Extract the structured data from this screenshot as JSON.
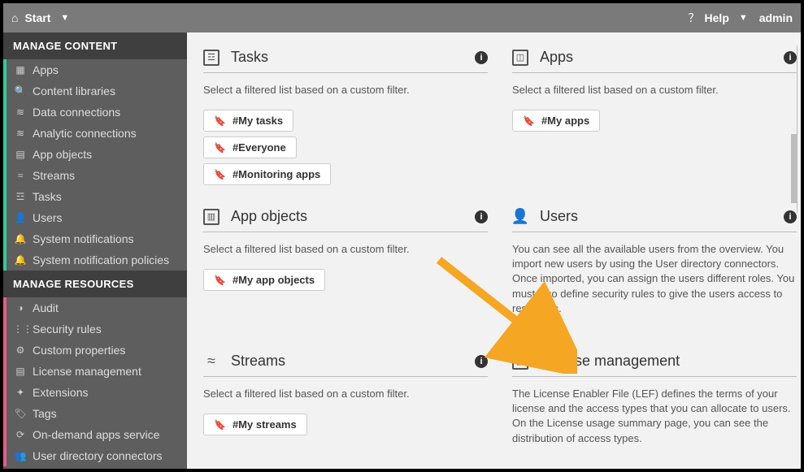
{
  "topbar": {
    "title": "Start",
    "help": "Help",
    "user": "admin"
  },
  "sidebar": {
    "head1": "MANAGE CONTENT",
    "head2": "MANAGE RESOURCES",
    "content": [
      {
        "label": "Apps",
        "icon": "▦"
      },
      {
        "label": "Content libraries",
        "icon": "🔍"
      },
      {
        "label": "Data connections",
        "icon": "≋"
      },
      {
        "label": "Analytic connections",
        "icon": "≋"
      },
      {
        "label": "App objects",
        "icon": "▤"
      },
      {
        "label": "Streams",
        "icon": "≈"
      },
      {
        "label": "Tasks",
        "icon": "☲"
      },
      {
        "label": "Users",
        "icon": "👤"
      },
      {
        "label": "System notifications",
        "icon": "🔔"
      },
      {
        "label": "System notification policies",
        "icon": "🔔"
      }
    ],
    "resources": [
      {
        "label": "Audit",
        "icon": "◑"
      },
      {
        "label": "Security rules",
        "icon": "⋮⋮"
      },
      {
        "label": "Custom properties",
        "icon": "⚙"
      },
      {
        "label": "License management",
        "icon": "▤"
      },
      {
        "label": "Extensions",
        "icon": "✦"
      },
      {
        "label": "Tags",
        "icon": "🏷"
      },
      {
        "label": "On-demand apps service",
        "icon": "⟳"
      },
      {
        "label": "User directory connectors",
        "icon": "👥"
      }
    ]
  },
  "cards": {
    "tasks": {
      "title": "Tasks",
      "desc": "Select a filtered list based on a custom filter.",
      "pills": [
        "#My tasks",
        "#Everyone",
        "#Monitoring apps"
      ]
    },
    "apps": {
      "title": "Apps",
      "desc": "Select a filtered list based on a custom filter.",
      "pills": [
        "#My apps"
      ]
    },
    "appobjects": {
      "title": "App objects",
      "desc": "Select a filtered list based on a custom filter.",
      "pills": [
        "#My app objects"
      ]
    },
    "users": {
      "title": "Users",
      "desc": "You can see all the available users from the overview. You import new users by using the User directory connectors. Once imported, you can assign the users different roles. You must also define security rules to give the users access to resources."
    },
    "streams": {
      "title": "Streams",
      "desc": "Select a filtered list based on a custom filter.",
      "pills": [
        "#My streams"
      ]
    },
    "license": {
      "title": "License management",
      "desc": "The License Enabler File (LEF) defines the terms of your license and the access types that you can allocate to users. On the License usage summary page, you can see the distribution of access types."
    }
  }
}
